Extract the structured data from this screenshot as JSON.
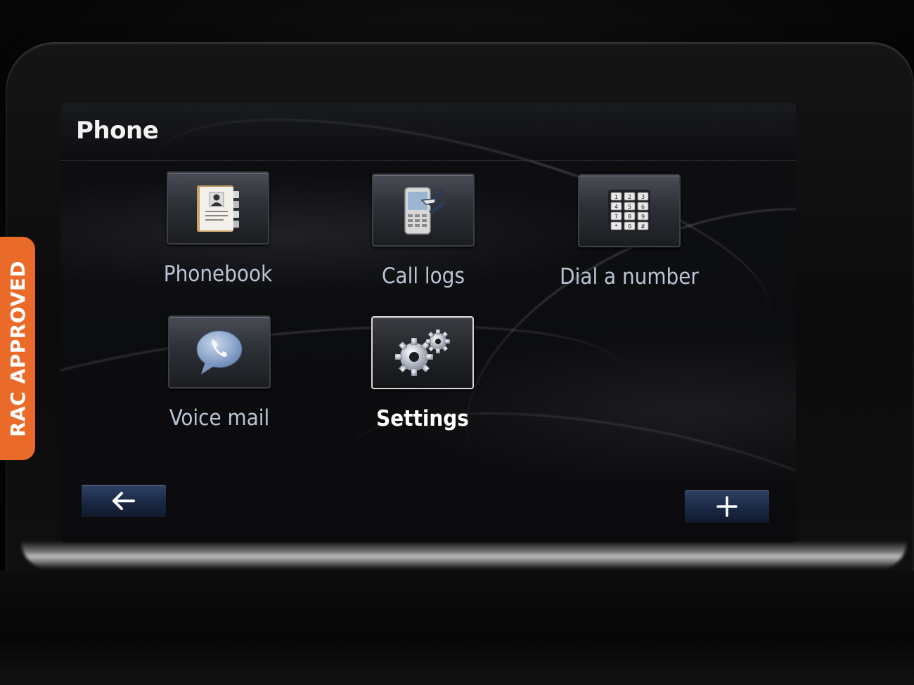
{
  "screen": {
    "title": "Phone"
  },
  "tiles": [
    {
      "label": "Phonebook",
      "icon": "phonebook-icon",
      "selected": false
    },
    {
      "label": "Call logs",
      "icon": "call-logs-icon",
      "selected": false
    },
    {
      "label": "Dial a number",
      "icon": "keypad-icon",
      "selected": false
    },
    {
      "label": "Voice mail",
      "icon": "voicemail-icon",
      "selected": false
    },
    {
      "label": "Settings",
      "icon": "settings-gears-icon",
      "selected": true
    }
  ],
  "nav": {
    "back_icon": "arrow-left-icon",
    "more_icon": "plus-icon"
  },
  "badge": {
    "text": "RAC APPROVED",
    "color": "#ea6a2a"
  }
}
